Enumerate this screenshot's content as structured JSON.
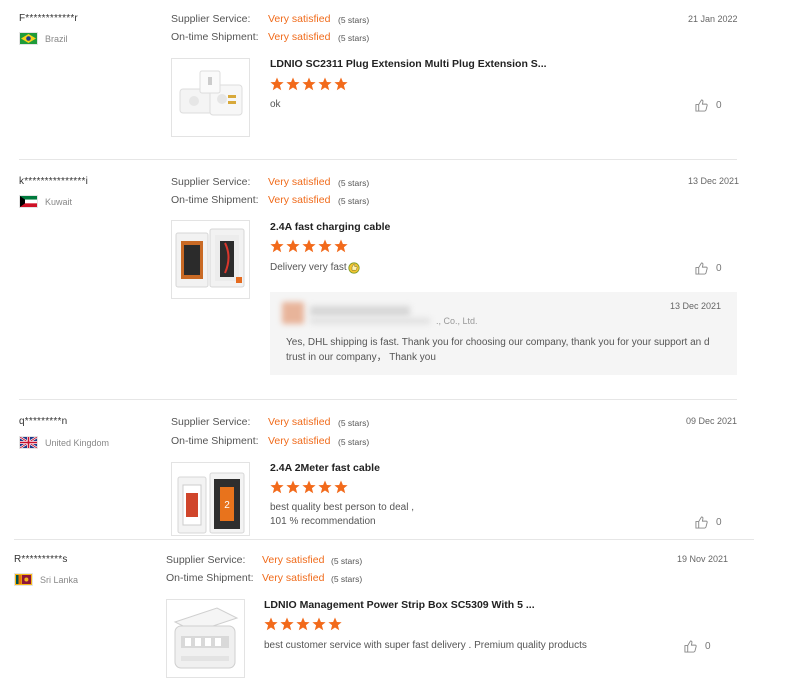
{
  "labels": {
    "supplier_service": "Supplier Service:",
    "on_time_shipment": "On-time Shipment:"
  },
  "reviews": [
    {
      "buyer": "F************r",
      "country": "Brazil",
      "supplier_rating": "Very satisfied",
      "supplier_stars": "(5 stars)",
      "shipment_rating": "Very satisfied",
      "shipment_stars": "(5 stars)",
      "date": "21 Jan 2022",
      "product": "LDNIO SC2311 Plug Extension Multi Plug Extension S...",
      "stars": 5,
      "comment": "ok",
      "likes": "0"
    },
    {
      "buyer": "k***************i",
      "country": "Kuwait",
      "supplier_rating": "Very satisfied",
      "supplier_stars": "(5 stars)",
      "shipment_rating": "Very satisfied",
      "shipment_stars": "(5 stars)",
      "date": "13 Dec 2021",
      "product": "2.4A fast charging cable",
      "stars": 5,
      "comment": "Delivery very fast",
      "likes": "0",
      "reply": {
        "company_suffix": "., Co., Ltd.",
        "date": "13 Dec 2021",
        "text": "Yes, DHL shipping is fast. Thank you for choosing our company, thank you for your support an d trust in our company，  Thank you"
      }
    },
    {
      "buyer": "q*********n",
      "country": "United Kingdom",
      "supplier_rating": "Very satisfied",
      "supplier_stars": "(5 stars)",
      "shipment_rating": "Very satisfied",
      "shipment_stars": "(5 stars)",
      "date": "09 Dec 2021",
      "product": "2.4A 2Meter fast cable",
      "stars": 5,
      "comment_line1": "best quality best person to deal ,",
      "comment_line2": "101 % recommendation",
      "likes": "0"
    },
    {
      "buyer": "R**********s",
      "country": "Sri Lanka",
      "supplier_rating": "Very satisfied",
      "supplier_stars": "(5 stars)",
      "shipment_rating": "Very satisfied",
      "shipment_stars": "(5 stars)",
      "date": "19 Nov 2021",
      "product": "LDNIO Management Power Strip Box SC5309 With 5 ...",
      "stars": 5,
      "comment": "best customer service with super fast delivery . Premium quality products",
      "likes": "0"
    }
  ],
  "colors": {
    "accent": "#f06b1b",
    "star": "#f26a1b"
  },
  "icons": {
    "like": "thumbs-up-icon",
    "star": "star-icon"
  }
}
